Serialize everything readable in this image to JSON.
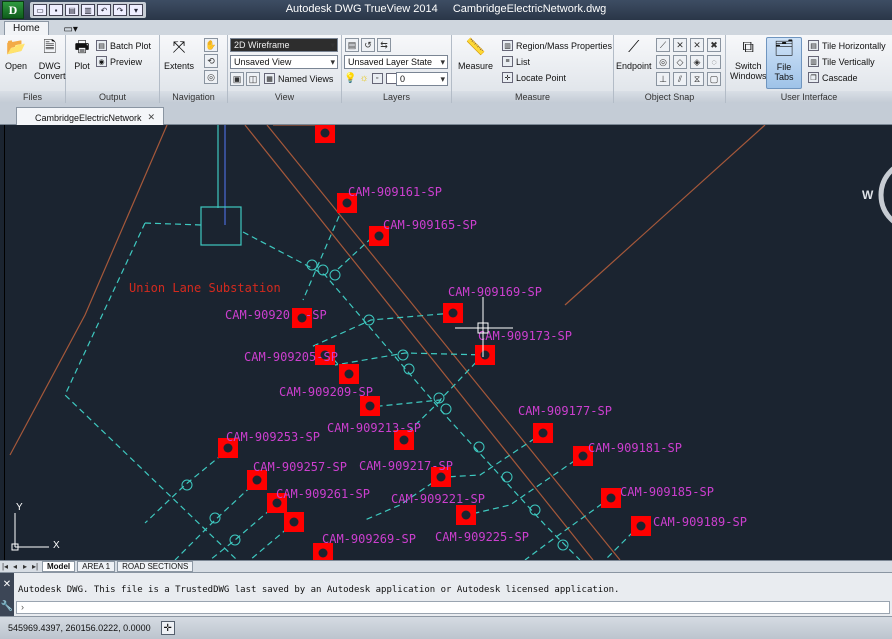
{
  "window": {
    "app_title": "Autodesk DWG TrueView 2014",
    "file_title": "CambridgeElectricNetwork.dwg",
    "app_button": "D"
  },
  "ribbon": {
    "tabs": [
      {
        "label": "Home"
      }
    ],
    "panels": {
      "files": {
        "title": "Files",
        "open": "Open",
        "dwg_convert_1": "DWG",
        "dwg_convert_2": "Convert"
      },
      "output": {
        "title": "Output",
        "plot": "Plot",
        "batch_plot": "Batch Plot",
        "preview": "Preview"
      },
      "navigation": {
        "title": "Navigation",
        "extents": "Extents"
      },
      "view": {
        "title": "View",
        "visual_style": "2D Wireframe",
        "saved_view": "Unsaved View",
        "named_views": "Named Views"
      },
      "layers": {
        "title": "Layers",
        "layer_state": "Unsaved Layer State",
        "current_layer": "0"
      },
      "measure": {
        "title": "Measure",
        "measure": "Measure",
        "region_mass": "Region/Mass Properties",
        "list": "List",
        "locate_point": "Locate Point"
      },
      "object_snap": {
        "title": "Object Snap",
        "endpoint": "Endpoint"
      },
      "user_interface": {
        "title": "User Interface",
        "switch_windows_1": "Switch",
        "switch_windows_2": "Windows",
        "file_tabs": "File Tabs",
        "tile_horizontally": "Tile Horizontally",
        "tile_vertically": "Tile Vertically",
        "cascade": "Cascade"
      }
    }
  },
  "document_tab": {
    "label": "CambridgeElectricNetwork"
  },
  "drawing": {
    "substation_label": "Union Lane Substation",
    "compass_letter": "W",
    "ucs_x": "X",
    "ucs_y": "Y",
    "labels": [
      "CAM-909161-SP",
      "CAM-909165-SP",
      "CAM-909169-SP",
      "CAM-909173-SP",
      "CAM-90920",
      "CAM-909205-SP",
      "CAM-909209-SP",
      "CAM-909213-SP",
      "CAM-909177-SP",
      "CAM-909181-SP",
      "CAM-909253-SP",
      "CAM-909257-SP",
      "CAM-909217-SP",
      "CAM-909261-SP",
      "CAM-909221-SP",
      "CAM-909185-SP",
      "CAM-909189-SP",
      "CAM-909269-SP",
      "CAM-909225-SP"
    ]
  },
  "layout_tabs": [
    {
      "label": "Model"
    },
    {
      "label": "AREA 1"
    },
    {
      "label": "ROAD SECTIONS"
    }
  ],
  "command_line": {
    "history": "Autodesk DWG.  This file is a TrustedDWG last saved by an Autodesk application or Autodesk licensed application.",
    "prompt": "›"
  },
  "status": {
    "coordinates": "545969.4397, 260156.0222, 0.0000"
  },
  "colors": {
    "background": "#1b2430",
    "cyan_line": "#3ec9c0",
    "brown_line": "#a5583a",
    "magenta_text": "#cc3fcf",
    "red_marker": "#ff0000"
  }
}
